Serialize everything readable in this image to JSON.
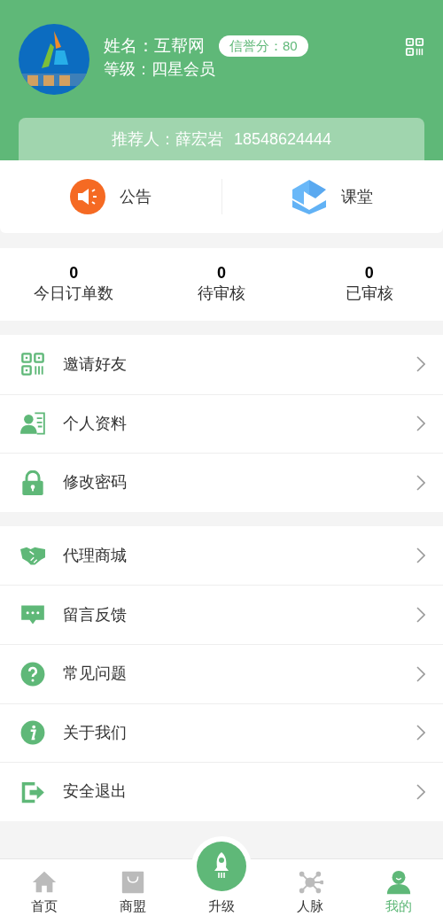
{
  "profile": {
    "name": "姓名：互帮网",
    "credit": "信誉分：80",
    "level": "等级：四星会员",
    "referrer": "推荐人：薛宏岩",
    "referrer_phone": "18548624444"
  },
  "shortcuts": [
    {
      "kind": "notice",
      "label": "公告"
    },
    {
      "kind": "class",
      "label": "课堂"
    }
  ],
  "stats": [
    {
      "value": "0",
      "label": "今日订单数"
    },
    {
      "value": "0",
      "label": "待审核"
    },
    {
      "value": "0",
      "label": "已审核"
    }
  ],
  "menu_groups": [
    [
      {
        "kind": "qr",
        "label": "邀请好友"
      },
      {
        "kind": "profile",
        "label": "个人资料"
      },
      {
        "kind": "lock",
        "label": "修改密码"
      }
    ],
    [
      {
        "kind": "handshake",
        "label": "代理商城"
      },
      {
        "kind": "chat",
        "label": "留言反馈"
      },
      {
        "kind": "question",
        "label": "常见问题"
      },
      {
        "kind": "info",
        "label": "关于我们"
      },
      {
        "kind": "logout",
        "label": "安全退出"
      }
    ]
  ],
  "tabbar": [
    {
      "kind": "home",
      "label": "首页",
      "selected": false
    },
    {
      "kind": "bag",
      "label": "商盟",
      "selected": false
    },
    {
      "kind": "rocket",
      "label": "升级",
      "selected": false
    },
    {
      "kind": "network",
      "label": "人脉",
      "selected": false
    },
    {
      "kind": "user",
      "label": "我的",
      "selected": true
    }
  ]
}
